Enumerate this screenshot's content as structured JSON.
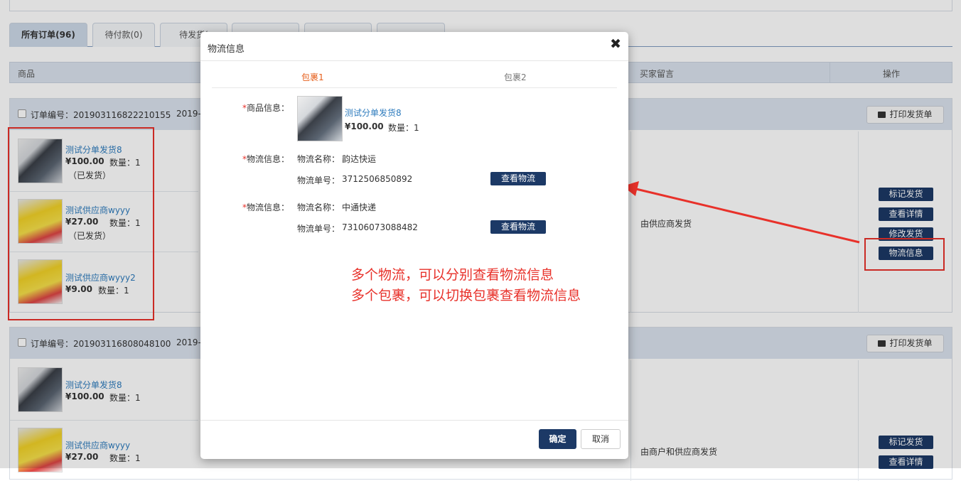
{
  "tabs": [
    {
      "label": "所有订单(96)",
      "active": true
    },
    {
      "label": "待付款(0)",
      "active": false
    },
    {
      "label": "待发货(",
      "active": false
    },
    {
      "label": "",
      "active": false
    },
    {
      "label": "",
      "active": false
    },
    {
      "label": "",
      "active": false
    }
  ],
  "table_header": {
    "product": "商品",
    "remark": "买家留言",
    "action": "操作"
  },
  "orders": [
    {
      "order_no": "订单编号：201903116822210155",
      "date": "2019-",
      "print_label": "打印发货单",
      "remark": "由供应商发货",
      "items": [
        {
          "title": "测试分单发货8",
          "price": "¥100.00",
          "qty": "数量：1",
          "status": "（已发货）"
        },
        {
          "title": "测试供应商wyyy",
          "price": "¥27.00",
          "qty": "数量：1",
          "status": "（已发货）"
        },
        {
          "title": "测试供应商wyyy2",
          "price": "¥9.00",
          "qty": "数量：1",
          "status": ""
        }
      ],
      "actions": [
        "标记发货",
        "查看详情",
        "修改发货",
        "物流信息"
      ]
    },
    {
      "order_no": "订单编号：201903116808048100",
      "date": "2019-",
      "print_label": "打印发货单",
      "remark": "由商户和供应商发货",
      "items": [
        {
          "title": "测试分单发货8",
          "price": "¥100.00",
          "qty": "数量：1",
          "status": ""
        },
        {
          "title": "测试供应商wyyy",
          "price": "¥27.00",
          "qty": "数量：1",
          "status": ""
        }
      ],
      "actions": [
        "标记发货",
        "查看详情"
      ]
    }
  ],
  "modal": {
    "title": "物流信息",
    "close": "✖",
    "package_tabs": [
      "包裹1",
      "包裹2"
    ],
    "product_label": "商品信息：",
    "product": {
      "title": "测试分单发货8",
      "price": "¥100.00",
      "qty": "数量：1"
    },
    "logistics": [
      {
        "label": "物流信息：",
        "name_label": "物流名称：",
        "name": "韵达快运",
        "no_label": "物流单号：",
        "no": "3712506850892",
        "button": "查看物流"
      },
      {
        "label": "物流信息：",
        "name_label": "物流名称：",
        "name": "中通快递",
        "no_label": "物流单号：",
        "no": "73106073088482",
        "button": "查看物流"
      }
    ],
    "annotation": [
      "多个物流，可以分别查看物流信息",
      "多个包裹，可以切换包裹查看物流信息"
    ],
    "ok": "确定",
    "cancel": "取消"
  },
  "colors": {
    "accent": "#1c3966",
    "annotation": "#e8312a",
    "active_tab": "#e65e1a",
    "link": "#2d7bbd"
  }
}
